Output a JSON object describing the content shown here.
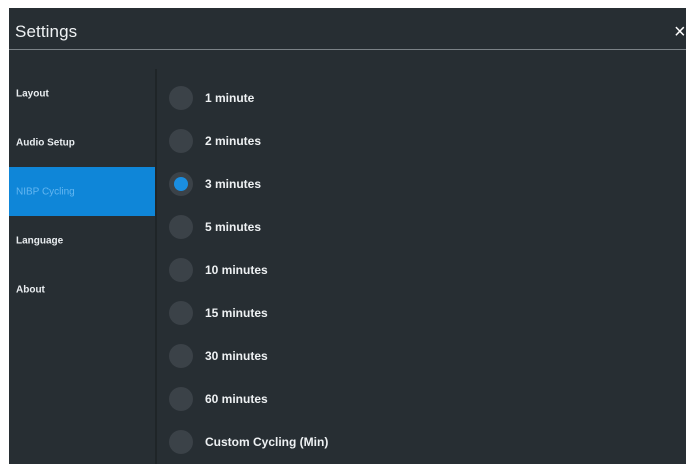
{
  "header": {
    "title": "Settings",
    "close_symbol": "×"
  },
  "sidebar": {
    "items": [
      {
        "label": "Layout",
        "active": false
      },
      {
        "label": "Audio Setup",
        "active": false
      },
      {
        "label": "NIBP Cycling",
        "active": true
      },
      {
        "label": "Language",
        "active": false
      },
      {
        "label": "About",
        "active": false
      }
    ]
  },
  "options": [
    {
      "label": "1 minute",
      "selected": false
    },
    {
      "label": "2 minutes",
      "selected": false
    },
    {
      "label": "3 minutes",
      "selected": true
    },
    {
      "label": "5 minutes",
      "selected": false
    },
    {
      "label": "10 minutes",
      "selected": false
    },
    {
      "label": "15 minutes",
      "selected": false
    },
    {
      "label": "30 minutes",
      "selected": false
    },
    {
      "label": "60 minutes",
      "selected": false
    },
    {
      "label": "Custom Cycling (Min)",
      "selected": false
    }
  ],
  "colors": {
    "background": "#272e33",
    "accent": "#0f86d8",
    "radio_off": "#3b4248",
    "radio_on": "#1a8ee0",
    "text": "#eef1f3"
  },
  "icons": {
    "close": "close-icon",
    "radio": "radio-icon"
  }
}
